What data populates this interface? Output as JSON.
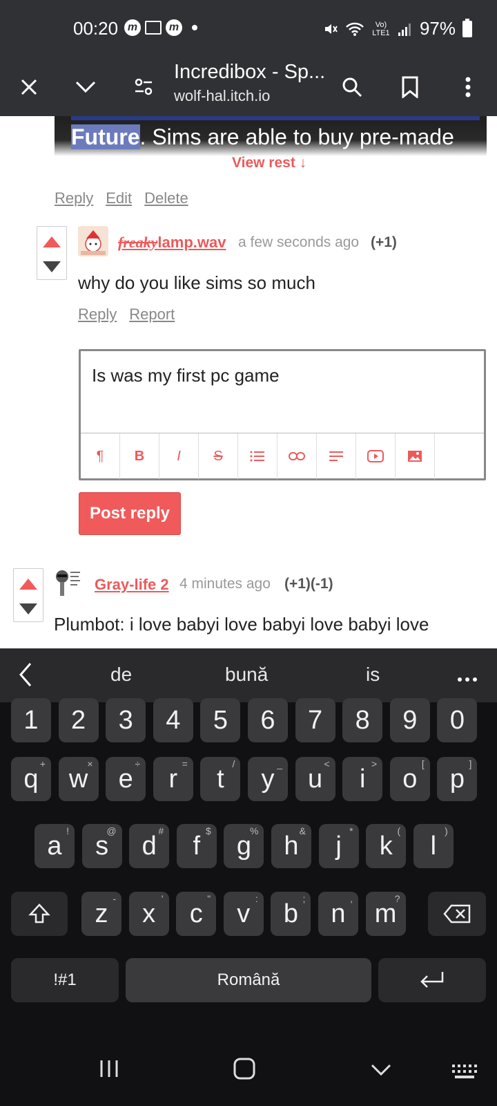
{
  "status_bar": {
    "time": "00:20",
    "battery": "97%",
    "network_label": "Vo) LTE1"
  },
  "browser": {
    "title": "Incredibox - Sp...",
    "url": "wolf-hal.itch.io"
  },
  "post_excerpt": {
    "highlight": "Future",
    "rest": ". Sims are able to buy pre-made",
    "view_rest": "View rest ↓"
  },
  "post_links": [
    "Reply",
    "Edit",
    "Delete"
  ],
  "comment1": {
    "author_prefix": "freaky",
    "author": "lamp.wav",
    "time": "a few seconds ago",
    "score": "(+1)",
    "body": "why do you like sims so much",
    "links": [
      "Reply",
      "Report"
    ]
  },
  "reply_editor": {
    "text": "Is was my first pc game",
    "toolbar": [
      "paragraph-icon",
      "bold-icon",
      "italic-icon",
      "strikethrough-icon",
      "list-icon",
      "link-icon",
      "align-icon",
      "youtube-icon",
      "image-icon"
    ],
    "toolbar_labels": [
      "¶",
      "B",
      "I",
      "S",
      "≡",
      "⛓",
      "≡",
      "▶",
      "▣"
    ]
  },
  "post_reply_label": "Post reply",
  "comment2": {
    "author": "Gray-life 2",
    "time": "4 minutes ago",
    "score": "(+1)(-1)",
    "body": "Plumbot: i love babyi love babyi love babyi love"
  },
  "keyboard": {
    "suggestions": [
      "de",
      "bună",
      "is"
    ],
    "row_numbers": [
      "1",
      "2",
      "3",
      "4",
      "5",
      "6",
      "7",
      "8",
      "9",
      "0"
    ],
    "row1": [
      [
        "q",
        "+"
      ],
      [
        "w",
        "×"
      ],
      [
        "e",
        "÷"
      ],
      [
        "r",
        "="
      ],
      [
        "t",
        "/"
      ],
      [
        "y",
        "_"
      ],
      [
        "u",
        "<"
      ],
      [
        "i",
        ">"
      ],
      [
        "o",
        "["
      ],
      [
        "p",
        "]"
      ]
    ],
    "row2": [
      [
        "a",
        "!"
      ],
      [
        "s",
        "@"
      ],
      [
        "d",
        "#"
      ],
      [
        "f",
        "$"
      ],
      [
        "g",
        "%"
      ],
      [
        "h",
        "&"
      ],
      [
        "j",
        "*"
      ],
      [
        "k",
        "("
      ],
      [
        "l",
        ")"
      ]
    ],
    "row3": [
      [
        "z",
        "-"
      ],
      [
        "x",
        "'"
      ],
      [
        "c",
        "\""
      ],
      [
        "v",
        ":"
      ],
      [
        "b",
        ";"
      ],
      [
        "n",
        ","
      ],
      [
        "m",
        "?"
      ]
    ],
    "symbols_label": "!#1",
    "space_label": "Română"
  }
}
